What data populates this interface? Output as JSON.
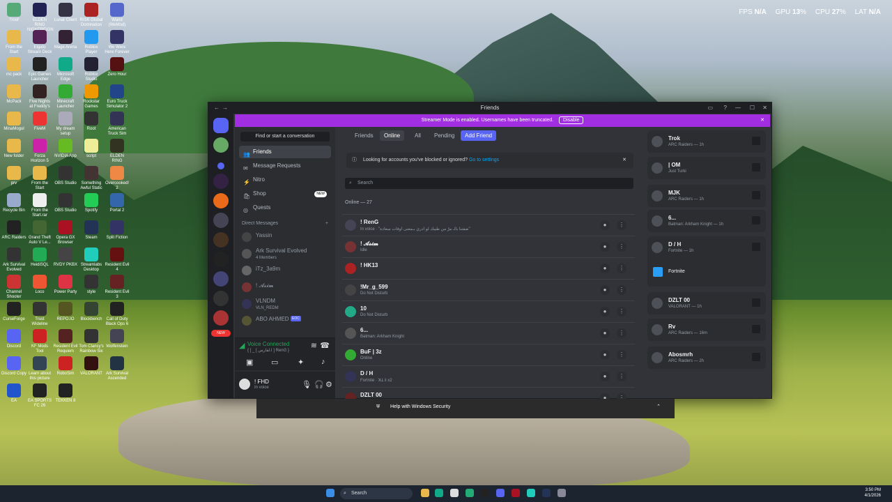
{
  "desktop": {
    "icons": [
      {
        "label": "?roof",
        "color": "#5a7"
      },
      {
        "label": "ELDEN RING NIGHTREIGN",
        "color": "#225"
      },
      {
        "label": "Lunar Client",
        "color": "#334"
      },
      {
        "label": "RISK Global Domination",
        "color": "#a22"
      },
      {
        "label": "Wand (WeMod)",
        "color": "#56c"
      },
      {
        "label": "From the Start",
        "color": "#e8b84a"
      },
      {
        "label": "Elgato Stream Deck",
        "color": "#525"
      },
      {
        "label": "Mage Arena",
        "color": "#323"
      },
      {
        "label": "Roblox Player",
        "color": "#29e"
      },
      {
        "label": "We Were Here Forever",
        "color": "#336"
      },
      {
        "label": "mc pack",
        "color": "#e8b84a"
      },
      {
        "label": "Epic Games Launcher",
        "color": "#222"
      },
      {
        "label": "Microsoft Edge",
        "color": "#1a8"
      },
      {
        "label": "Roblox Studio",
        "color": "#223"
      },
      {
        "label": "Zero Hour",
        "color": "#511"
      },
      {
        "label": "McPack",
        "color": "#e8b84a"
      },
      {
        "label": "Five Nights at Freddy's",
        "color": "#322"
      },
      {
        "label": "Minecraft Launcher",
        "color": "#3a3"
      },
      {
        "label": "Rockstar Games",
        "color": "#e90"
      },
      {
        "label": "Euro Truck Simulator 2",
        "color": "#248"
      },
      {
        "label": "MinaMogul",
        "color": "#e8b84a"
      },
      {
        "label": "FiveM",
        "color": "#e33"
      },
      {
        "label": "My dream setup",
        "color": "#aab"
      },
      {
        "label": "Root",
        "color": "#333"
      },
      {
        "label": "American Truck Sim",
        "color": "#335"
      },
      {
        "label": "New folder",
        "color": "#e8b84a"
      },
      {
        "label": "Forza Horizon 5",
        "color": "#c2a"
      },
      {
        "label": "NVIDIA App",
        "color": "#6b2"
      },
      {
        "label": "script",
        "color": "#ee9"
      },
      {
        "label": "ELDEN RING",
        "color": "#332"
      },
      {
        "label": "prv",
        "color": "#e8b84a"
      },
      {
        "label": "From the Start",
        "color": "#e8b84a"
      },
      {
        "label": "OBS Studio",
        "color": "#333"
      },
      {
        "label": "Something Awful Static",
        "color": "#433"
      },
      {
        "label": "Overcooked! 2",
        "color": "#e84"
      },
      {
        "label": "Recycle Bin",
        "color": "#9ac"
      },
      {
        "label": "From the Start.rar",
        "color": "#eee"
      },
      {
        "label": "OBS Studio",
        "color": "#333"
      },
      {
        "label": "Spotify",
        "color": "#2c5"
      },
      {
        "label": "Portal 2",
        "color": "#36a"
      },
      {
        "label": "ARC Raiders",
        "color": "#222"
      },
      {
        "label": "Grand Theft Auto V Le...",
        "color": "#463"
      },
      {
        "label": "Opera GX Browser",
        "color": "#a12"
      },
      {
        "label": "Steam",
        "color": "#235"
      },
      {
        "label": "Split Fiction",
        "color": "#336"
      },
      {
        "label": "Ark Survival Evolved",
        "color": "#333"
      },
      {
        "label": "HeidiSQL",
        "color": "#2a5"
      },
      {
        "label": "RVDY PKBX",
        "color": "#444"
      },
      {
        "label": "Streamlabs Desktop",
        "color": "#2cb"
      },
      {
        "label": "Resident Evil 4",
        "color": "#611"
      },
      {
        "label": "Channel Shooter",
        "color": "#c33"
      },
      {
        "label": "Loco",
        "color": "#e53"
      },
      {
        "label": "Power Party",
        "color": "#d34"
      },
      {
        "label": "style",
        "color": "#333"
      },
      {
        "label": "Resident Evil 3",
        "color": "#622"
      },
      {
        "label": "CurseForge",
        "color": "#222"
      },
      {
        "label": "Trust Wideline",
        "color": "#333"
      },
      {
        "label": "REPO.IO",
        "color": "#552"
      },
      {
        "label": "Blockbench",
        "color": "#343"
      },
      {
        "label": "Call of Duty Black Ops 6",
        "color": "#222"
      },
      {
        "label": "Discord",
        "color": "#5865f2"
      },
      {
        "label": "KF Mods Tool",
        "color": "#c22"
      },
      {
        "label": "Resident Evil Requiem",
        "color": "#522"
      },
      {
        "label": "Tom Clancy's Rainbow Six",
        "color": "#333"
      },
      {
        "label": "Wolfenstein",
        "color": "#445"
      },
      {
        "label": "Discord Copy",
        "color": "#5865f2"
      },
      {
        "label": "Learn about this picture",
        "color": "#345"
      },
      {
        "label": "RoboSim",
        "color": "#c22"
      },
      {
        "label": "VALORANT",
        "color": "#311"
      },
      {
        "label": "Ark Survival Ascended",
        "color": "#234"
      },
      {
        "label": "EA",
        "color": "#25c"
      },
      {
        "label": "EA SPORTS FC 26",
        "color": "#222"
      },
      {
        "label": "TEKKEN 8",
        "color": "#222"
      }
    ]
  },
  "overlay": {
    "fps_label": "FPS",
    "fps": "N/A",
    "gpu_label": "GPU",
    "gpu": "13",
    "cpu_label": "CPU",
    "cpu": "27",
    "lat_label": "LAT",
    "lat": "N/A",
    "pct": "%"
  },
  "window": {
    "title": "Friends",
    "back": "←",
    "fwd": "→"
  },
  "streamer": {
    "text": "Streamer Mode is enabled. Usernames have been truncated.",
    "disable": "Disable",
    "close": "✕"
  },
  "side": {
    "find": "Find or start a conversation",
    "nav": [
      {
        "label": "Friends",
        "icon": "👥"
      },
      {
        "label": "Message Requests",
        "icon": "✉"
      },
      {
        "label": "Nitro",
        "icon": "⚡"
      },
      {
        "label": "Shop",
        "icon": "🛍"
      },
      {
        "label": "Quests",
        "icon": "◎"
      }
    ],
    "new_badge": "NEW",
    "dm_header": "Direct Messages",
    "dm_add": "+",
    "dms": [
      {
        "name": "Yassin",
        "sub": ""
      },
      {
        "name": "Ark Survival Evolved",
        "sub": "4 Members"
      },
      {
        "name": "iTz_3a9m",
        "sub": ""
      },
      {
        "name": "! 𝓐𝓼𝓲𝓶",
        "sub": ""
      },
      {
        "name": "VLNDM",
        "sub": "VLN_REDM"
      },
      {
        "name": "ABO AHMED",
        "sub": "",
        "tag": "EOC"
      }
    ],
    "voice": {
      "title": "Voice Connected",
      "sub": "{ [ _ [ ا.لفارس ] RenG }"
    },
    "user": {
      "name": "! FHD",
      "status": "In voice"
    }
  },
  "main": {
    "tabs": [
      {
        "label": "Friends"
      },
      {
        "label": "Online"
      },
      {
        "label": "All"
      },
      {
        "label": "Pending"
      },
      {
        "label": "Add Friend"
      }
    ],
    "notice": {
      "text": "Looking for accounts you've blocked or ignored?",
      "link": "Go to settings",
      "close": "✕"
    },
    "search_placeholder": "Search",
    "online_header": "Online — 27",
    "friends": [
      {
        "name": "! RenG",
        "status": "In voice · \"ضفتنا بالـ مرّ من طيبك لو ادري بـمعنى اوقات سعادة\""
      },
      {
        "name": "! 𝓐𝓼𝓲𝓶",
        "status": "Idle"
      },
      {
        "name": "! HK13",
        "status": ""
      },
      {
        "name": "!Mr_g_599",
        "status": "Do Not Disturb"
      },
      {
        "name": "10",
        "status": "Do Not Disturb"
      },
      {
        "name": "6...",
        "status": "Batman: Arkham Knight"
      },
      {
        "name": "BuF | 3z",
        "status": "Online"
      },
      {
        "name": "D / H",
        "status": "Fortnite · ꓘꓕ ii x2"
      },
      {
        "name": "DZLT 00",
        "status": ""
      }
    ]
  },
  "active": [
    {
      "name": "Trok",
      "sub": "ARC Raiders — 1h"
    },
    {
      "name": "| OM",
      "sub": "Just Turki"
    },
    {
      "name": "MJK",
      "sub": "ARC Raiders — 1h"
    },
    {
      "name": "6...",
      "sub": "Batman: Arkham Knight — 1h"
    },
    {
      "name": "D / H",
      "sub": "Fortnite — 1h",
      "extra": "Fortnite"
    },
    {
      "name": "DZLT 00",
      "sub": "VALORANT — 1h"
    },
    {
      "name": "Rv",
      "sub": "ARC Raiders — 16m"
    },
    {
      "name": "Abosmrh",
      "sub": "ARC Raiders — 2h"
    }
  ],
  "security": {
    "text": "Help with Windows Security"
  },
  "taskbar": {
    "search": "Search",
    "time": "3:50 PM",
    "date": "4/1/2026"
  }
}
